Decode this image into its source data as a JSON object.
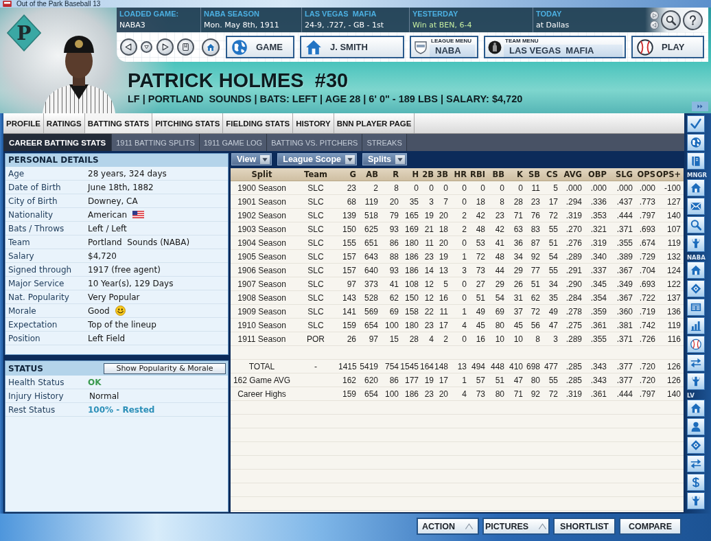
{
  "window": {
    "title": "Out of the Park Baseball 13"
  },
  "header": {
    "logo_letter": "P",
    "info": [
      {
        "label": "LOADED GAME:",
        "value": "NABA3",
        "color": "#ffffff"
      },
      {
        "label": "NABA SEASON",
        "value": "Mon. May 8th, 1911",
        "color": "#ffffff"
      },
      {
        "label": "LAS VEGAS  MAFIA",
        "value": "24-9, .727, - GB - 1st",
        "color": "#ffffff"
      },
      {
        "label": "YESTERDAY",
        "value": "Win at BEN, 6-4",
        "color": "#c6eea0"
      },
      {
        "label": "TODAY",
        "value": "at Dallas",
        "color": "#ffffff"
      }
    ],
    "nav_buttons": [
      {
        "kind": "plain",
        "label": "GAME"
      },
      {
        "kind": "plain",
        "label": "J. SMITH"
      },
      {
        "kind": "menu",
        "caption": "LEAGUE MENU",
        "label": "NABA"
      },
      {
        "kind": "menu",
        "caption": "TEAM MENU",
        "label": "LAS VEGAS  MAFIA"
      },
      {
        "kind": "plain",
        "label": "PLAY"
      }
    ],
    "player_name": "PATRICK HOLMES  #30",
    "player_summary": "LF | PORTLAND  SOUNDS | BATS: LEFT | AGE 28 | 6' 0\" - 189 LBS | SALARY: $4,720"
  },
  "tabs": [
    {
      "label": "PROFILE",
      "selected": false
    },
    {
      "label": "RATINGS",
      "selected": false
    },
    {
      "label": "BATTING STATS",
      "selected": true
    },
    {
      "label": "PITCHING STATS",
      "selected": false
    },
    {
      "label": "FIELDING STATS",
      "selected": false
    },
    {
      "label": "HISTORY",
      "selected": false
    },
    {
      "label": "BNN PLAYER PAGE",
      "selected": false
    }
  ],
  "subtabs": [
    {
      "label": "CAREER BATTING STATS",
      "selected": true
    },
    {
      "label": "1911 BATTING SPLITS",
      "selected": false
    },
    {
      "label": "1911 GAME LOG",
      "selected": false
    },
    {
      "label": "BATTING VS. PITCHERS",
      "selected": false
    },
    {
      "label": "STREAKS",
      "selected": false
    }
  ],
  "personal_details": {
    "title": "PERSONAL DETAILS",
    "rows": [
      {
        "kind": "text",
        "label": "Age",
        "value": "28 years, 324 days"
      },
      {
        "kind": "text",
        "label": "Date of Birth",
        "value": "June 18th, 1882"
      },
      {
        "kind": "text",
        "label": "City of Birth",
        "value": "Downey, CA"
      },
      {
        "kind": "flag",
        "label": "Nationality",
        "value": "American"
      },
      {
        "kind": "text",
        "label": "Bats / Throws",
        "value": "Left / Left"
      },
      {
        "kind": "text",
        "label": "Team",
        "value": "Portland  Sounds (NABA)"
      },
      {
        "kind": "text",
        "label": "Salary",
        "value": "$4,720"
      },
      {
        "kind": "text",
        "label": "Signed through",
        "value": "1917 (free agent)"
      },
      {
        "kind": "text",
        "label": "Major Service",
        "value": "10 Year(s), 129 Days"
      },
      {
        "kind": "text",
        "label": "Nat. Popularity",
        "value": "Very Popular"
      },
      {
        "kind": "mood",
        "label": "Morale",
        "value": "Good"
      },
      {
        "kind": "text",
        "label": "Expectation",
        "value": "Top of the lineup"
      },
      {
        "kind": "text",
        "label": "Position",
        "value": "Left Field"
      }
    ]
  },
  "status": {
    "title": "STATUS",
    "button": "Show Popularity & Morale",
    "rows": [
      {
        "label": "Health Status",
        "value": "OK",
        "color": "#3a9a4e"
      },
      {
        "label": "Injury History",
        "value": "Normal"
      },
      {
        "label": "Rest Status",
        "value": "100% - Rested",
        "color": "#2b8fb8"
      }
    ]
  },
  "stats_table": {
    "filters": [
      "View",
      "League Scope",
      "Splits"
    ],
    "columns": [
      "Split",
      "Team",
      "G",
      "AB",
      "R",
      "H",
      "2B",
      "3B",
      "HR",
      "RBI",
      "BB",
      "K",
      "SB",
      "CS",
      "AVG",
      "OBP",
      "SLG",
      "OPS",
      "OPS+"
    ],
    "rows": [
      {
        "split": "1900 Season",
        "team": "SLC",
        "stats": [
          "23",
          "2",
          "8",
          "0",
          "0",
          "0",
          "0",
          "0",
          "0",
          "0",
          "11",
          "5",
          ".000",
          ".000",
          ".000",
          ".000",
          "-100"
        ]
      },
      {
        "split": "1901 Season",
        "team": "SLC",
        "stats": [
          "68",
          "119",
          "20",
          "35",
          "3",
          "7",
          "0",
          "18",
          "8",
          "28",
          "23",
          "17",
          ".294",
          ".336",
          ".437",
          ".773",
          "127"
        ]
      },
      {
        "split": "1902 Season",
        "team": "SLC",
        "stats": [
          "139",
          "518",
          "79",
          "165",
          "19",
          "20",
          "2",
          "42",
          "23",
          "71",
          "76",
          "72",
          ".319",
          ".353",
          ".444",
          ".797",
          "140"
        ]
      },
      {
        "split": "1903 Season",
        "team": "SLC",
        "stats": [
          "150",
          "625",
          "93",
          "169",
          "21",
          "18",
          "2",
          "48",
          "42",
          "63",
          "83",
          "55",
          ".270",
          ".321",
          ".371",
          ".693",
          "107"
        ]
      },
      {
        "split": "1904 Season",
        "team": "SLC",
        "stats": [
          "155",
          "651",
          "86",
          "180",
          "11",
          "20",
          "0",
          "53",
          "41",
          "36",
          "87",
          "51",
          ".276",
          ".319",
          ".355",
          ".674",
          "119"
        ]
      },
      {
        "split": "1905 Season",
        "team": "SLC",
        "stats": [
          "157",
          "643",
          "88",
          "186",
          "23",
          "19",
          "1",
          "72",
          "48",
          "34",
          "92",
          "54",
          ".289",
          ".340",
          ".389",
          ".729",
          "132"
        ]
      },
      {
        "split": "1906 Season",
        "team": "SLC",
        "stats": [
          "157",
          "640",
          "93",
          "186",
          "14",
          "13",
          "3",
          "73",
          "44",
          "29",
          "77",
          "55",
          ".291",
          ".337",
          ".367",
          ".704",
          "124"
        ]
      },
      {
        "split": "1907 Season",
        "team": "SLC",
        "stats": [
          "97",
          "373",
          "41",
          "108",
          "12",
          "5",
          "0",
          "27",
          "29",
          "26",
          "51",
          "34",
          ".290",
          ".345",
          ".349",
          ".693",
          "122"
        ]
      },
      {
        "split": "1908 Season",
        "team": "SLC",
        "stats": [
          "143",
          "528",
          "62",
          "150",
          "12",
          "16",
          "0",
          "51",
          "54",
          "31",
          "62",
          "35",
          ".284",
          ".354",
          ".367",
          ".722",
          "137"
        ]
      },
      {
        "split": "1909 Season",
        "team": "SLC",
        "stats": [
          "141",
          "569",
          "69",
          "158",
          "22",
          "11",
          "1",
          "49",
          "69",
          "37",
          "72",
          "49",
          ".278",
          ".359",
          ".360",
          ".719",
          "136"
        ]
      },
      {
        "split": "1910 Season",
        "team": "SLC",
        "stats": [
          "159",
          "654",
          "100",
          "180",
          "23",
          "17",
          "4",
          "45",
          "80",
          "45",
          "56",
          "47",
          ".275",
          ".361",
          ".381",
          ".742",
          "119"
        ]
      },
      {
        "split": "1911 Season",
        "team": "POR",
        "stats": [
          "26",
          "97",
          "15",
          "28",
          "4",
          "2",
          "0",
          "16",
          "10",
          "10",
          "8",
          "3",
          ".289",
          ".355",
          ".371",
          ".726",
          "116"
        ]
      }
    ],
    "summary_rows": [
      {
        "split": "TOTAL",
        "team": "-",
        "stats": [
          "1415",
          "5419",
          "754",
          "1545",
          "164",
          "148",
          "13",
          "494",
          "448",
          "410",
          "698",
          "477",
          ".285",
          ".343",
          ".377",
          ".720",
          "126"
        ]
      },
      {
        "split": "162 Game AVG",
        "stats": [
          "162",
          "620",
          "86",
          "177",
          "19",
          "17",
          "1",
          "57",
          "51",
          "47",
          "80",
          "55",
          ".285",
          ".343",
          ".377",
          ".720",
          "126"
        ]
      },
      {
        "split": "Career Highs",
        "stats": [
          "159",
          "654",
          "100",
          "186",
          "23",
          "20",
          "4",
          "73",
          "80",
          "71",
          "92",
          "72",
          ".319",
          ".361",
          ".444",
          ".797",
          "140"
        ]
      }
    ]
  },
  "sidebar": {
    "sections": [
      {
        "label": "MNGR"
      },
      {
        "label": "NABA"
      },
      {
        "label": "LV"
      }
    ]
  },
  "bottom_buttons": [
    {
      "kind": "menu",
      "label": "ACTION"
    },
    {
      "kind": "menu",
      "label": "PICTURES"
    },
    {
      "kind": "plain",
      "label": "SHORTLIST"
    },
    {
      "kind": "plain",
      "label": "COMPARE"
    }
  ]
}
